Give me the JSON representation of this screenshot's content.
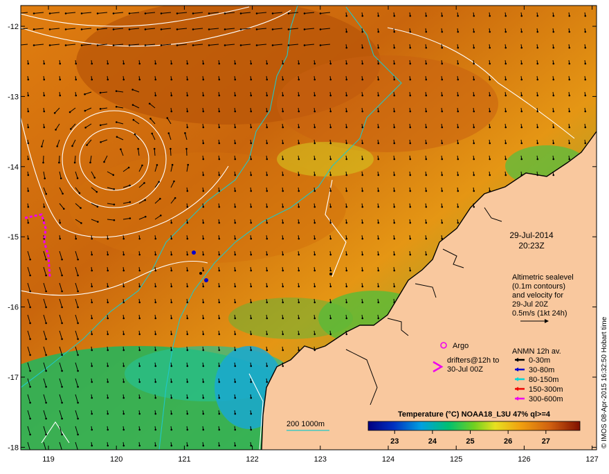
{
  "map": {
    "lon_ticks": [
      "119",
      "120",
      "121",
      "122",
      "123",
      "124",
      "125",
      "126",
      "127"
    ],
    "lat_ticks": [
      "-12",
      "-13",
      "-14",
      "-15",
      "-16",
      "-17",
      "-18"
    ]
  },
  "annotations": {
    "date": "29-Jul-2014",
    "time": "20:23Z",
    "altimetry_lines": [
      "Altimetric sealevel",
      "(0.1m contours)",
      "and velocity for",
      "29-Jul 20Z",
      "0.5m/s (1kt 24h)"
    ]
  },
  "legend": {
    "argo_label": "Argo",
    "drifters_lines": [
      "drifters@12h to",
      "30-Jul 00Z"
    ],
    "anmn_title": "ANMN 12h av.",
    "anmn_items": [
      {
        "label": "0-30m",
        "color": "#000000"
      },
      {
        "label": "30-80m",
        "color": "#0000cc"
      },
      {
        "label": "80-150m",
        "color": "#00d8d8"
      },
      {
        "label": "150-300m",
        "color": "#ee0000"
      },
      {
        "label": "300-600m",
        "color": "#ee00ee"
      }
    ],
    "isobath_label": "200  1000m"
  },
  "colorbar": {
    "title": "Temperature (°C) NOAA18_L3U 47% ql>=4",
    "ticks": [
      "23",
      "24",
      "25",
      "26",
      "27"
    ],
    "range": [
      22.3,
      27.9
    ]
  },
  "credit": "© IMOS 08-Apr-2015 16:32:50 Hobart time",
  "colors": {
    "land": "#f9c89e",
    "warm": "#c0600a",
    "cool": "#1e3fa8",
    "isobath": "#20c8c8",
    "contour": "#ffffff"
  }
}
